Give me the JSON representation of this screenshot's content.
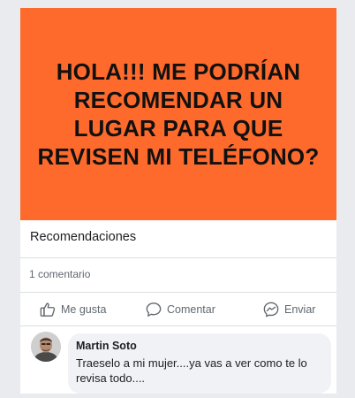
{
  "post": {
    "banner_text": "HOLA!!! ME PODRÍAN RECOMENDAR UN LUGAR PARA QUE REVISEN MI TELÉFONO?",
    "banner_color": "#fe6a2c",
    "section_title": "Recomendaciones",
    "comment_count": "1 comentario"
  },
  "actions": {
    "like_label": "Me gusta",
    "comment_label": "Comentar",
    "send_label": "Enviar",
    "like_icon": "thumbs-up-icon",
    "comment_icon": "speech-bubble-icon",
    "send_icon": "messenger-icon"
  },
  "comment": {
    "author": "Martin Soto",
    "text": "Traeselo a mi mujer....ya vas a ver como te lo revisa todo...."
  }
}
